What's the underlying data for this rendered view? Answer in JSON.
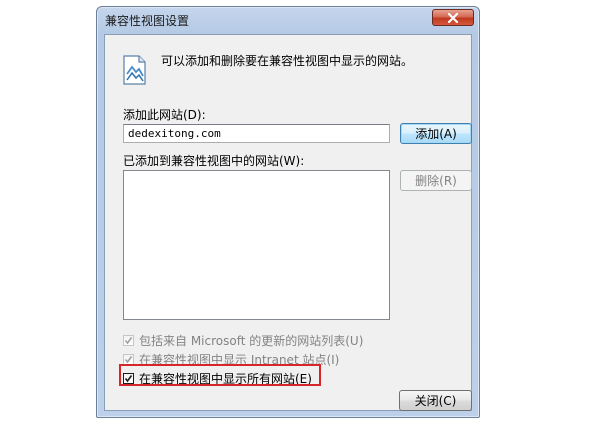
{
  "window": {
    "title": "兼容性视图设置"
  },
  "info": {
    "text": "可以添加和删除要在兼容性视图中显示的网站。"
  },
  "add_site": {
    "label": "添加此网站(D):",
    "value": "dedexitong.com",
    "button_label": "添加(A)"
  },
  "added_sites": {
    "label": "已添加到兼容性视图中的网站(W):",
    "items": [],
    "remove_button_label": "删除(R)"
  },
  "options": [
    {
      "label": "包括来自 Microsoft 的更新的网站列表(U)",
      "checked": true,
      "enabled": false
    },
    {
      "label": "在兼容性视图中显示 Intranet 站点(I)",
      "checked": true,
      "enabled": false
    },
    {
      "label": "在兼容性视图中显示所有网站(E)",
      "checked": true,
      "enabled": true
    }
  ],
  "footer": {
    "close_button_label": "关闭(C)"
  },
  "colors": {
    "highlight_box": "#d6252b",
    "close_button": "#c0391f"
  }
}
